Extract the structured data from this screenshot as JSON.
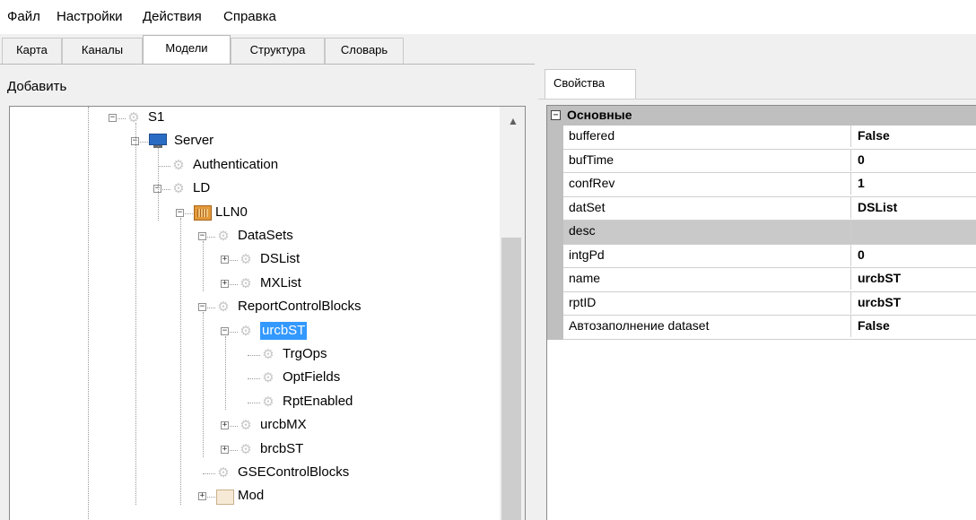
{
  "menu": [
    "Файл",
    "Настройки",
    "Действия",
    "Справка"
  ],
  "tabs": [
    {
      "label": "Карта",
      "active": false
    },
    {
      "label": "Каналы",
      "active": false
    },
    {
      "label": "Модели",
      "active": true
    },
    {
      "label": "Структура",
      "active": false
    },
    {
      "label": "Словарь",
      "active": false
    }
  ],
  "left": {
    "add_label": "Добавить"
  },
  "tree": {
    "nodes": [
      {
        "label": "S1",
        "icon": "gear-icon",
        "expander": "minus"
      },
      {
        "label": "Server",
        "icon": "monitor-icon",
        "expander": "minus"
      },
      {
        "label": "Authentication",
        "icon": "gear-icon",
        "expander": ""
      },
      {
        "label": "LD",
        "icon": "gear-icon",
        "expander": "minus"
      },
      {
        "label": "LLN0",
        "icon": "logical-node-icon",
        "expander": "minus"
      },
      {
        "label": "DataSets",
        "icon": "gear-icon",
        "expander": "minus"
      },
      {
        "label": "DSList",
        "icon": "gear-icon",
        "expander": "plus"
      },
      {
        "label": "MXList",
        "icon": "gear-icon",
        "expander": "plus"
      },
      {
        "label": "ReportControlBlocks",
        "icon": "gear-icon",
        "expander": "minus"
      },
      {
        "label": "urcbST",
        "icon": "gear-icon",
        "expander": "minus",
        "selected": true
      },
      {
        "label": "TrgOps",
        "icon": "gear-icon",
        "expander": ""
      },
      {
        "label": "OptFields",
        "icon": "gear-icon",
        "expander": ""
      },
      {
        "label": "RptEnabled",
        "icon": "gear-icon",
        "expander": ""
      },
      {
        "label": "urcbMX",
        "icon": "gear-icon",
        "expander": "plus"
      },
      {
        "label": "brcbST",
        "icon": "gear-icon",
        "expander": "plus"
      },
      {
        "label": "GSEControlBlocks",
        "icon": "gear-icon",
        "expander": ""
      },
      {
        "label": "Mod",
        "icon": "folder-icon",
        "expander": "plus"
      }
    ]
  },
  "right": {
    "tab_label": "Свойства",
    "category": "Основные",
    "properties": [
      {
        "name": "buffered",
        "value": "False"
      },
      {
        "name": "bufTime",
        "value": "0"
      },
      {
        "name": "confRev",
        "value": "1"
      },
      {
        "name": "datSet",
        "value": "DSList"
      },
      {
        "name": "desc",
        "value": ""
      },
      {
        "name": "intgPd",
        "value": "0"
      },
      {
        "name": "name",
        "value": "urcbST"
      },
      {
        "name": "rptID",
        "value": "urcbST"
      },
      {
        "name": "Автозаполнение dataset",
        "value": "False"
      }
    ]
  },
  "colors": {
    "selection": "#3399ff",
    "panel": "#f0f0f0",
    "category": "#bfbfbf"
  }
}
